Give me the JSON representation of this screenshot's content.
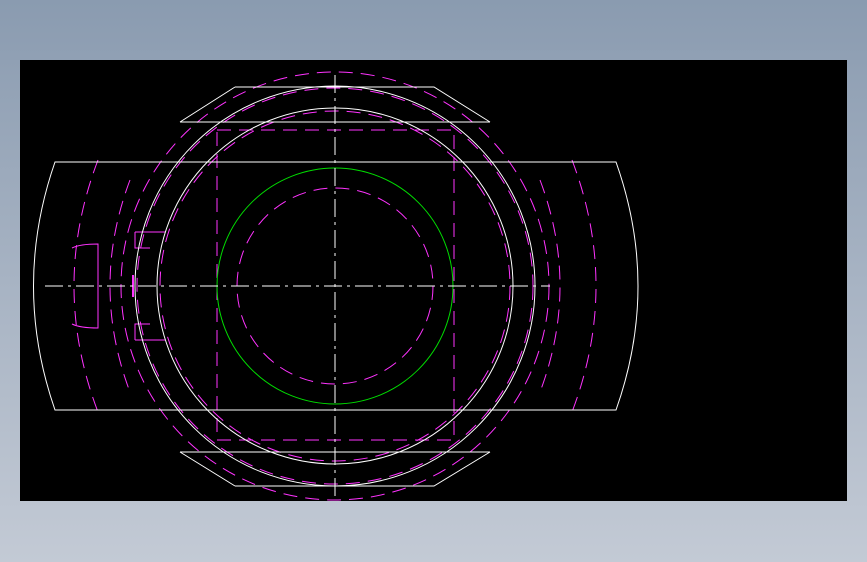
{
  "viewport": {
    "background": "#000000",
    "colors": {
      "visible_edge": "#ffffff",
      "hidden_line": "#ff33ff",
      "bore_circle": "#00dd00",
      "center_line": "#ffffff"
    }
  }
}
